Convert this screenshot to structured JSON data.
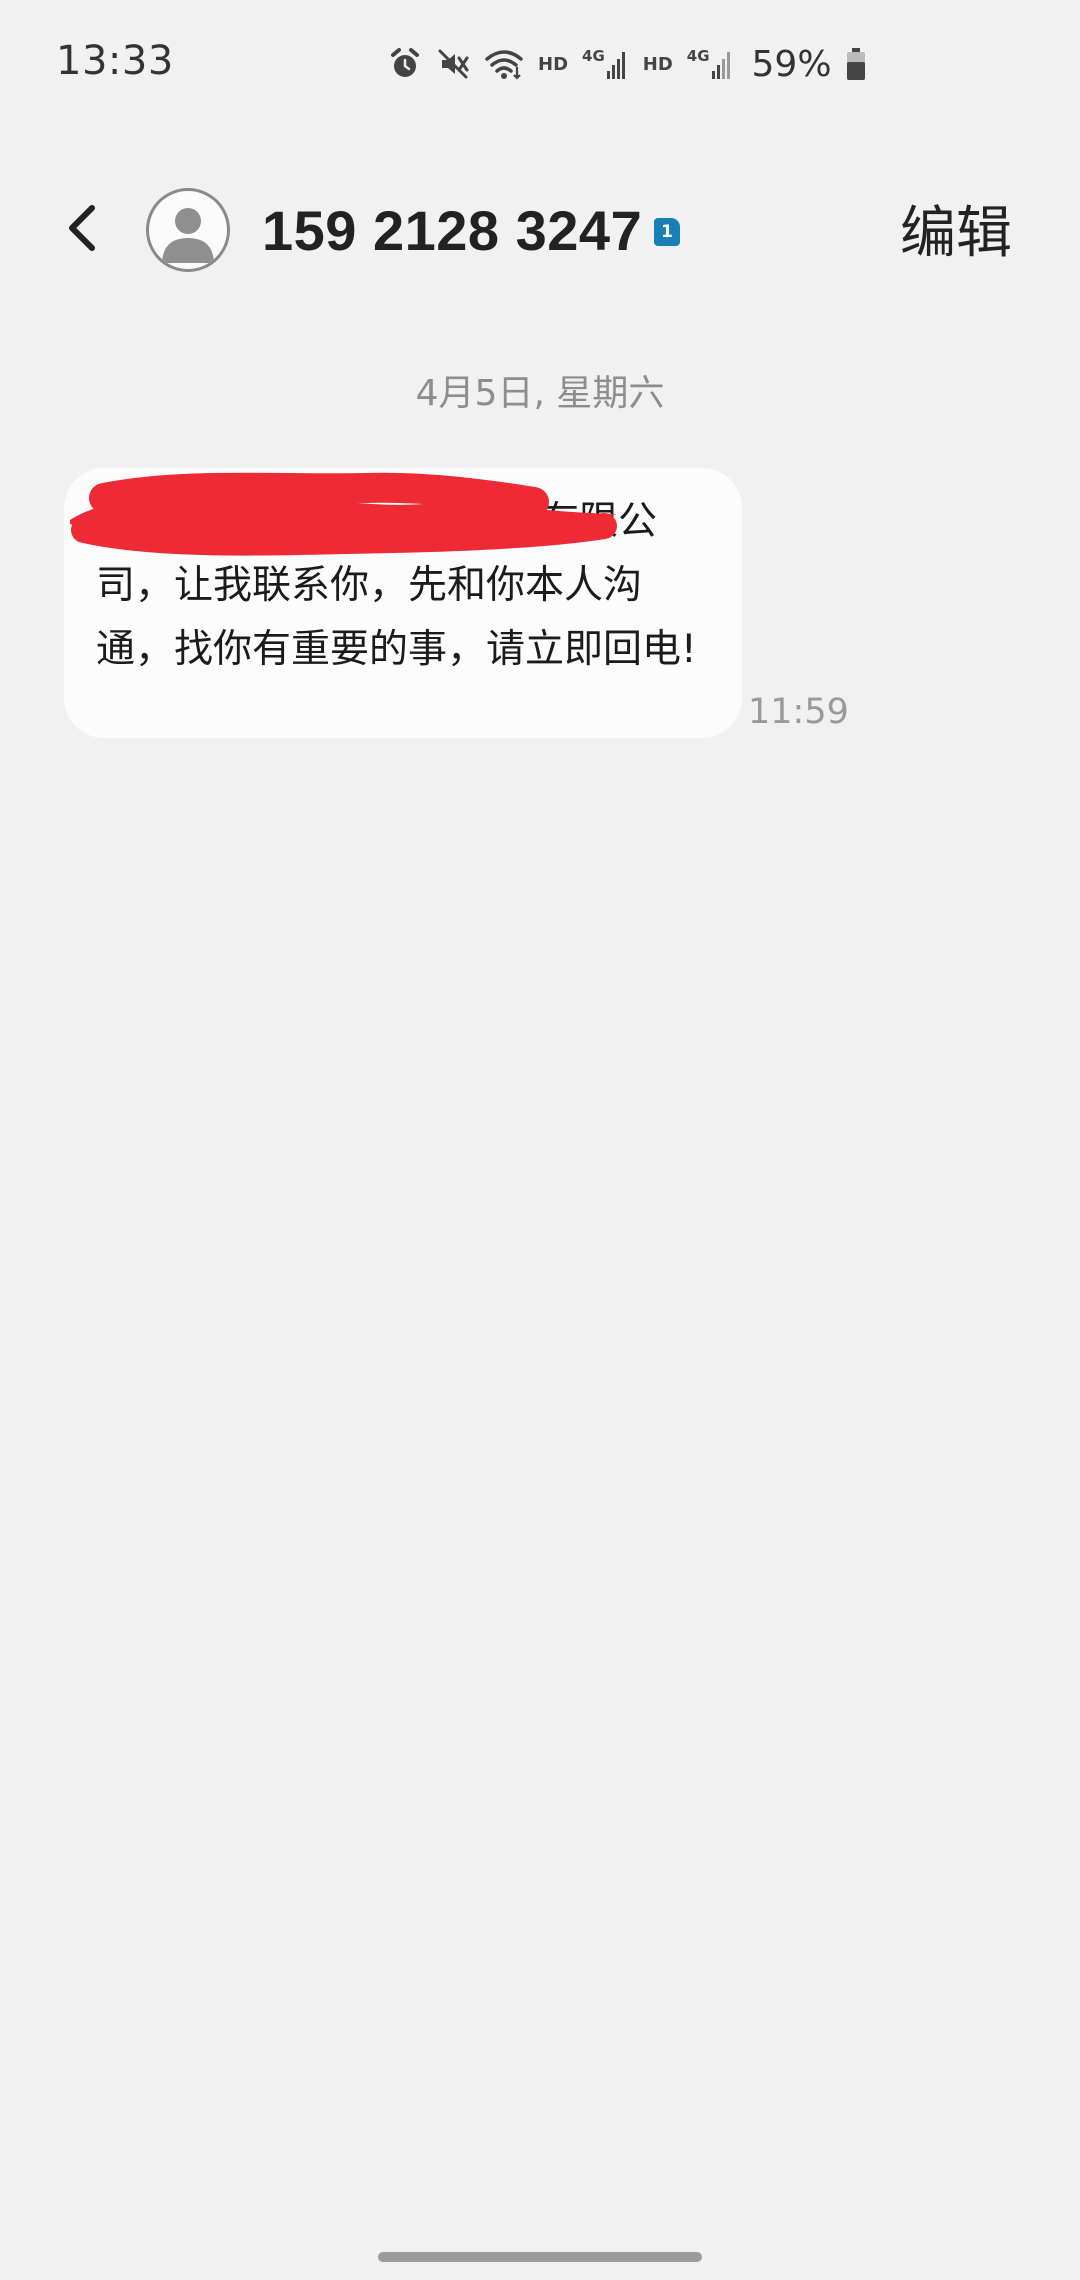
{
  "status_bar": {
    "time": "13:33",
    "hd_label_1": "HD",
    "net_label_1": "4G",
    "hd_label_2": "HD",
    "net_label_2": "4G",
    "battery": "59%"
  },
  "header": {
    "title": "159 2128 3247",
    "sim_badge": "1",
    "edit_label": "编辑"
  },
  "conversation": {
    "date_separator": "4月5日, 星期六",
    "messages": [
      {
        "text": "有限公司，让我联系你，先和你本人沟通，找你有重要的事，请立即回电!",
        "time": "11:59",
        "redacted": true
      }
    ]
  },
  "colors": {
    "background": "#f1f1f1",
    "bubble": "#fcfcfc",
    "sim_badge": "#1a7fb4",
    "redaction": "#ee2b35"
  },
  "icons": [
    "alarm-icon",
    "mute-icon",
    "wifi-icon",
    "signal-icon",
    "battery-icon",
    "back-arrow-icon",
    "person-icon"
  ]
}
